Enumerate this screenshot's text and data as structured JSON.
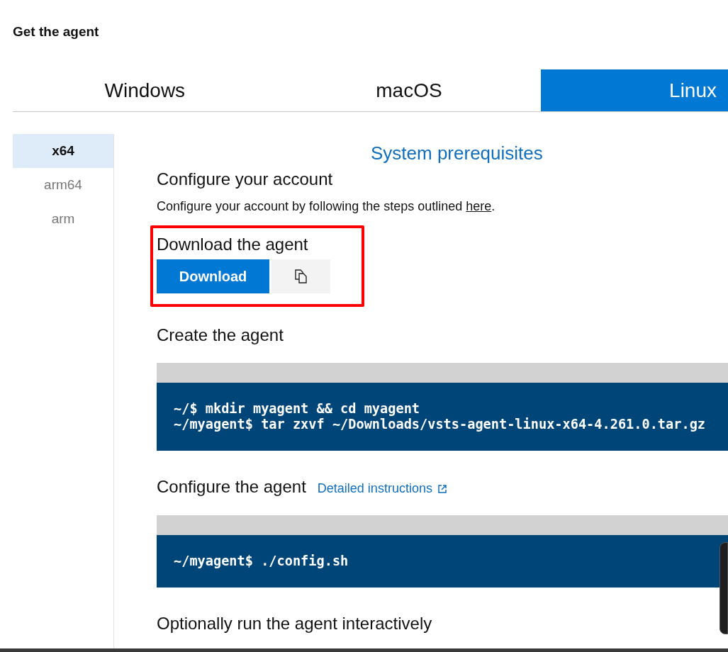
{
  "title": "Get the agent",
  "tabs": [
    {
      "label": "Windows",
      "selected": false
    },
    {
      "label": "macOS",
      "selected": false
    },
    {
      "label": "Linux",
      "selected": true
    }
  ],
  "sidebar": {
    "items": [
      {
        "label": "x64",
        "selected": true
      },
      {
        "label": "arm64",
        "selected": false
      },
      {
        "label": "arm",
        "selected": false
      }
    ]
  },
  "prerequisites_link": "System prerequisites",
  "sections": [
    {
      "kind": "text",
      "heading": "Configure your account",
      "text": "Configure your account by following the steps outlined ",
      "link": "here",
      "after": "."
    },
    {
      "kind": "download",
      "heading": "Download the agent",
      "button": "Download",
      "highlighted": true
    },
    {
      "kind": "code",
      "heading": "Create the agent",
      "lines": [
        "~/$ mkdir myagent && cd myagent",
        "~/myagent$ tar zxvf ~/Downloads/vsts-agent-linux-x64-4.261.0.tar.gz"
      ]
    },
    {
      "kind": "code",
      "heading": "Configure the agent",
      "link": "Detailed instructions",
      "lines": [
        "~/myagent$ ./config.sh"
      ]
    },
    {
      "kind": "heading",
      "heading": "Optionally run the agent interactively"
    }
  ]
}
